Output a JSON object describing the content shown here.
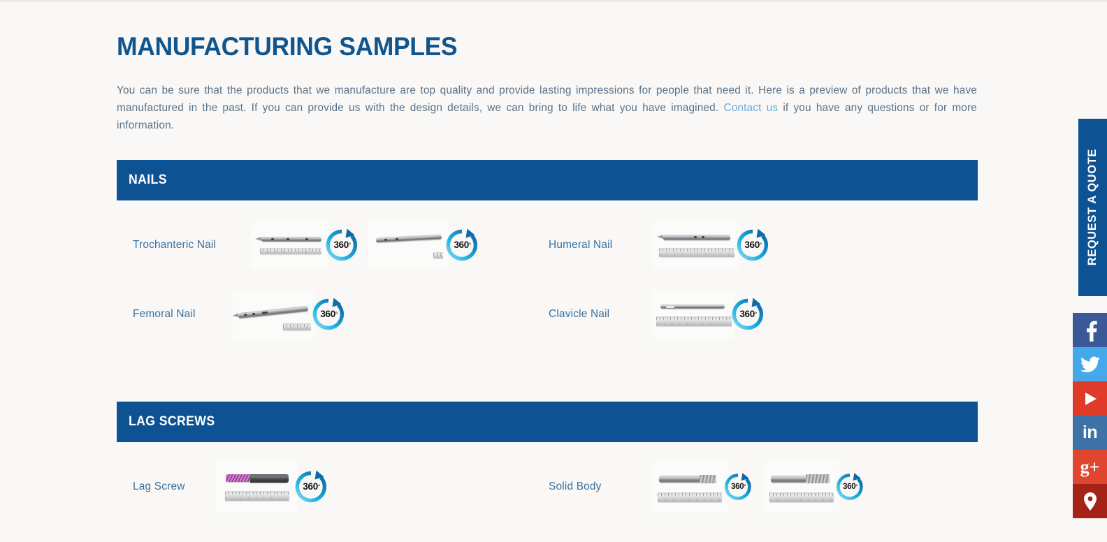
{
  "page": {
    "title": "MANUFACTURING SAMPLES",
    "intro_part1": "You can be sure that the products that we manufacture are top quality and provide lasting impressions for people that need it. Here is a preview of products that we have manufactured in the past. If you can provide us with the design details, we can bring to life what you have imagined. ",
    "intro_link": "Contact us",
    "intro_part2": " if you have any questions or for more information."
  },
  "colors": {
    "brand_blue": "#0d5293",
    "title_blue": "#10558d",
    "label_blue": "#3a6f9c",
    "body_text": "#5b7287",
    "link_blue": "#6aa9d8",
    "background": "#f9f8f6",
    "badge_cyan": "#1fb6e6",
    "badge_blue": "#0f6fae",
    "divider": "#e4e2e0"
  },
  "sections": [
    {
      "heading": "NAILS",
      "rows": [
        {
          "left": {
            "label": "Trochanteric Nail",
            "thumb_count": 2,
            "badge_label": "360",
            "badge_degree": "°"
          },
          "right": {
            "label": "Humeral Nail",
            "thumb_count": 1,
            "badge_label": "360",
            "badge_degree": "°"
          }
        },
        {
          "left": {
            "label": "Femoral Nail",
            "thumb_count": 1,
            "badge_label": "360",
            "badge_degree": "°"
          },
          "right": {
            "label": "Clavicle Nail",
            "thumb_count": 1,
            "badge_label": "360",
            "badge_degree": "°"
          }
        }
      ]
    },
    {
      "heading": "LAG SCREWS",
      "rows": [
        {
          "left": {
            "label": "Lag Screw",
            "thumb_count": 1,
            "badge_label": "360",
            "badge_degree": "°"
          },
          "right": {
            "label": "Solid Body",
            "thumb_count": 2,
            "badge_label": "360",
            "badge_degree": "°"
          }
        }
      ]
    }
  ],
  "right_rail": {
    "quote_tab_label": "REQUEST A QUOTE",
    "social": [
      {
        "name": "facebook",
        "glyph": "f",
        "color": "#3b5998"
      },
      {
        "name": "twitter",
        "glyph": "",
        "color": "#44a9e8"
      },
      {
        "name": "youtube",
        "glyph": "",
        "color": "#e03a28"
      },
      {
        "name": "linkedin",
        "glyph": "in",
        "color": "#3c72a5"
      },
      {
        "name": "googleplus",
        "glyph": "g+",
        "color": "#e0452f"
      },
      {
        "name": "location",
        "glyph": "",
        "color": "#a52217"
      }
    ]
  }
}
